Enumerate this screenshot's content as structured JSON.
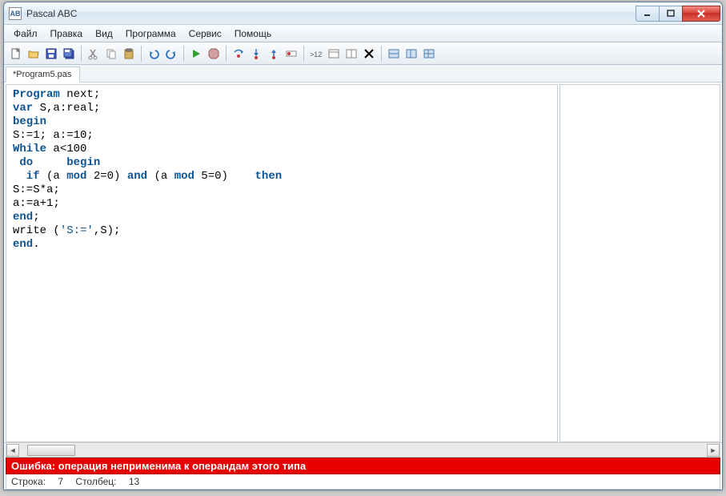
{
  "window": {
    "title": "Pascal ABC",
    "app_icon_text": "AB"
  },
  "menu": {
    "file": "Файл",
    "edit": "Правка",
    "view": "Вид",
    "program": "Программа",
    "service": "Сервис",
    "help": "Помощь"
  },
  "toolbar_icons": {
    "new": "new-file-icon",
    "open": "open-file-icon",
    "save": "save-icon",
    "save_all": "save-all-icon",
    "cut": "cut-icon",
    "copy": "copy-icon",
    "paste": "paste-icon",
    "undo": "undo-icon",
    "redo": "redo-icon",
    "run": "run-icon",
    "stop": "stop-icon",
    "step_over": "step-over-icon",
    "step_into": "step-into-icon",
    "step_out": "step-out-icon",
    "breakpoint": "breakpoint-icon",
    "eval": "eval-icon",
    "win1": "window1-icon",
    "win2": "window2-icon",
    "close_win": "close-window-icon",
    "layout1": "layout1-icon",
    "layout2": "layout2-icon",
    "layout3": "layout3-icon"
  },
  "tab": {
    "label": "*Program5.pas"
  },
  "code": {
    "l1a": "Program",
    "l1b": " next;",
    "l2a": "var",
    "l2b": " S,a:real;",
    "l3": "begin",
    "l4": "S:=1; a:=10;",
    "l5a": "While",
    "l5b": " a<100",
    "l6a": " do",
    "l6b": "     ",
    "l6c": "begin",
    "l7a": "  if",
    "l7b": " (a ",
    "l7c": "mod",
    "l7d": " 2=0) ",
    "l7e": "and",
    "l7f": " (a ",
    "l7g": "mod",
    "l7h": " 5=0)    ",
    "l7i": "then",
    "l8": "S:=S*a;",
    "l9": "a:=a+1;",
    "l10": "end",
    "l10b": ";",
    "l11a": "write (",
    "l11b": "'S:='",
    "l11c": ",S);",
    "l12": "end",
    "l12b": "."
  },
  "error": {
    "text": "Ошибка: операция неприменима к операндам этого типа"
  },
  "status": {
    "line_label": "Строка:",
    "line_value": "7",
    "col_label": "Столбец:",
    "col_value": "13"
  }
}
